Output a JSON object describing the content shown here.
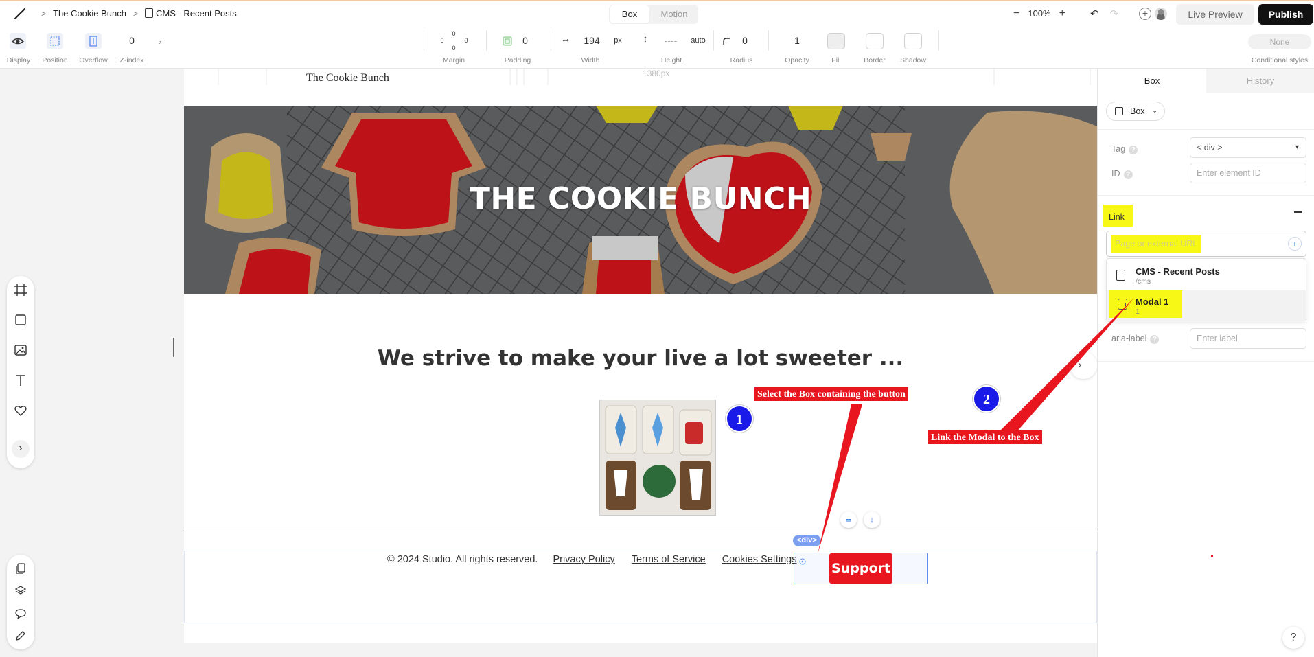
{
  "topbar": {
    "breadcrumbs": [
      "The Cookie Bunch",
      "CMS - Recent Posts"
    ],
    "mode_tabs": [
      "Box",
      "Motion"
    ],
    "zoom": "100%",
    "live_preview": "Live Preview",
    "publish": "Publish"
  },
  "toolbar": {
    "display": "Display",
    "position": "Position",
    "overflow": "Overflow",
    "z_index_label": "Z-index",
    "z_index_value": "0",
    "margin_label": "Margin",
    "margin_values": [
      "0",
      "0",
      "0",
      "0"
    ],
    "padding_label": "Padding",
    "padding_value": "0",
    "width_label": "Width",
    "width_value": "194",
    "width_unit": "px",
    "height_label": "Height",
    "height_value": "----",
    "height_unit": "auto",
    "radius_label": "Radius",
    "radius_value": "0",
    "opacity_label": "Opacity",
    "opacity_value": "1",
    "fill_label": "Fill",
    "border_label": "Border",
    "shadow_label": "Shadow",
    "conditional_value": "None",
    "conditional_label": "Conditional styles"
  },
  "canvas": {
    "width_label": "1380px",
    "site_name": "The Cookie Bunch",
    "hero_title": "THE COOKIE BUNCH",
    "tagline": "We strive to make your live a lot sweeter ...",
    "footer": {
      "copyright": "© 2024 Studio. All rights reserved.",
      "links": [
        "Privacy Policy",
        "Terms of Service",
        "Cookies Settings"
      ]
    },
    "div_tag": "<div>",
    "support_button": "Support"
  },
  "right_panel": {
    "tabs": [
      "Box",
      "History"
    ],
    "element_type": "Box",
    "tag_label": "Tag",
    "tag_value": "< div >",
    "id_label": "ID",
    "id_placeholder": "Enter element ID",
    "link_label": "Link",
    "link_placeholder": "Page or external URL",
    "link_options": [
      {
        "name": "CMS - Recent Posts",
        "sub": "/cms"
      },
      {
        "name": "Modal 1",
        "sub": "1"
      }
    ],
    "aria_label": "aria-label",
    "aria_placeholder": "Enter label"
  },
  "annotations": {
    "step1_num": "1",
    "step1_text": "Select the Box containing the button",
    "step2_num": "2",
    "step2_text": "Link the Modal to the Box"
  },
  "help": "?",
  "colors": {
    "annotation_red": "#e8161f",
    "annotation_blue": "#1a1ae8",
    "highlight_yellow": "#f8f817",
    "selection_blue": "#5b8ef0"
  }
}
